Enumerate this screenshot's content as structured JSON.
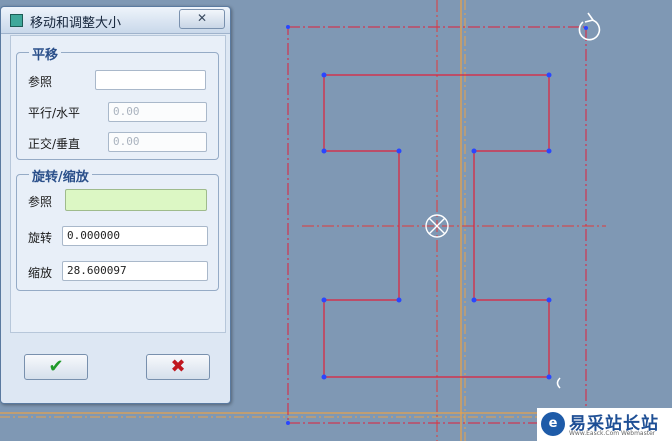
{
  "dialog": {
    "title": "移动和调整大小",
    "close_glyph": "✕",
    "translate_group": {
      "title": "平移",
      "reference_label": "参照",
      "reference_value": "",
      "horizontal_label": "平行/水平",
      "horizontal_value": "0.00",
      "vertical_label": "正交/垂直",
      "vertical_value": "0.00"
    },
    "rotate_scale_group": {
      "title": "旋转/缩放",
      "reference_label": "参照",
      "reference_value": "",
      "rotate_label": "旋转",
      "rotate_value": "0.000000",
      "scale_label": "缩放",
      "scale_value": "28.600097"
    },
    "ok_glyph": "✔",
    "cancel_glyph": "✖"
  },
  "watermark": {
    "logo_glyph": "e",
    "text": "易采站长站",
    "subtext": "Www.Easck.Com Webmaster"
  },
  "colors": {
    "canvas": "#7f98b4",
    "sketch_line": "#e0203a",
    "vertex": "#2a46ff",
    "centerline": "#e03a3a",
    "reference_axis": "#e8a24a",
    "accent_green": "#dcf7c4"
  }
}
